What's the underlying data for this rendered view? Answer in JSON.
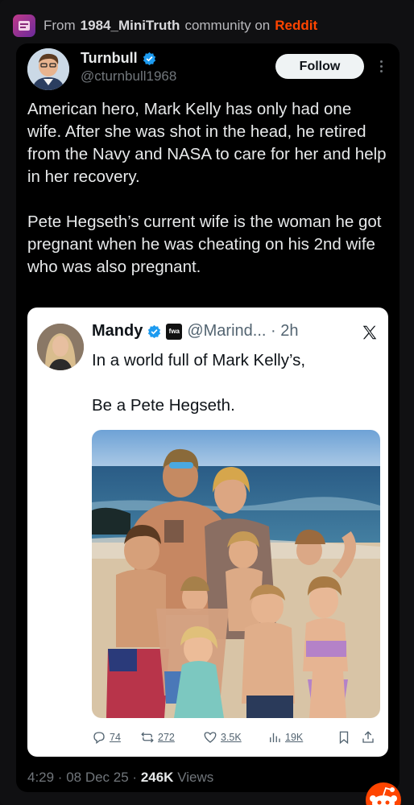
{
  "source": {
    "prefix": "From",
    "community": "1984_MiniTruth",
    "middle": "community on",
    "platform": "Reddit"
  },
  "post": {
    "author_name": "Turnbull",
    "author_handle": "@cturnbull1968",
    "follow_label": "Follow",
    "paragraphs": [
      "American hero, Mark Kelly has only had one wife. After she was shot in the head, he retired from the Navy and NASA to care for her and help in her recovery.",
      "Pete Hegseth’s current wife is the woman he got pregnant when he was cheating on his 2nd wife who was also pregnant."
    ],
    "time": "4:29 · 08 Dec 25 ·",
    "views_count": "246K",
    "views_label": "Views"
  },
  "quote": {
    "name": "Mandy",
    "org_badge": "fwa",
    "handle": "@Marind... · 2h",
    "lines": [
      "In a world full of Mark Kelly’s,",
      "Be a Pete Hegseth."
    ],
    "stats": {
      "replies": "74",
      "reposts": "272",
      "likes": "3.5K",
      "views": "19K"
    }
  },
  "icons": [
    "verified-icon",
    "more-icon",
    "x-logo-icon",
    "reply-icon",
    "repost-icon",
    "like-icon",
    "views-icon",
    "bookmark-icon",
    "share-icon",
    "reddit-snoo-icon"
  ],
  "colors": {
    "reddit_orange": "#ff4500",
    "verified_blue": "#1d9bf0",
    "background": "#000000"
  }
}
